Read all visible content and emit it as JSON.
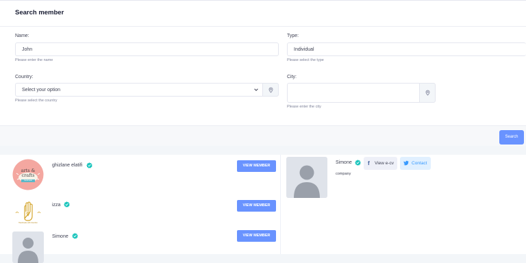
{
  "search_card": {
    "title": "Search member",
    "name": {
      "label": "Name:",
      "value": "John",
      "hint": "Please enter the name"
    },
    "type": {
      "label": "Type:",
      "value": "Individual",
      "hint": "Please select the type"
    },
    "country": {
      "label": "Country:",
      "selected": "Select your option",
      "hint": "Please select the country"
    },
    "city": {
      "label": "City:",
      "value": "",
      "hint": "Please enter the city"
    },
    "search_button": "Search"
  },
  "members": [
    {
      "name": "ghizlane elatifi",
      "logo_lines": [
        "arts &",
        "crafts",
        "handmade"
      ],
      "button": "VIEW MEMBER"
    },
    {
      "name": "izza",
      "logo_text": "Handmade with Intention",
      "button": "VIEW MEMBER"
    },
    {
      "name": "Simone",
      "button": "VIEW MEMBER"
    }
  ],
  "selected_member": {
    "name": "Simone",
    "cv_button": "View e-cv",
    "contact_button": "Contact",
    "type": "company"
  },
  "colors": {
    "primary": "#6993ff",
    "verified": "#1bc5bd",
    "twitter": "#1da1f2",
    "facebook": "#3b5998"
  }
}
